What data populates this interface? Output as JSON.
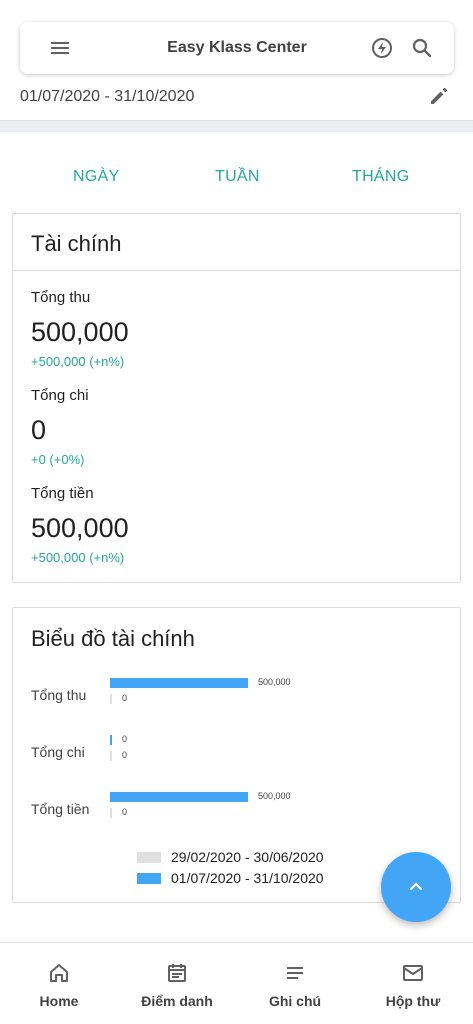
{
  "header": {
    "title": "Easy Klass Center",
    "icons": {
      "menu": "menu-icon",
      "flash": "flash-icon",
      "search": "search-icon"
    }
  },
  "date_range": {
    "value": "01/07/2020 - 31/10/2020",
    "edit_icon": "pencil-icon"
  },
  "tabs": [
    {
      "label": "NGÀY"
    },
    {
      "label": "TUẦN"
    },
    {
      "label": "THÁNG"
    }
  ],
  "finance": {
    "title": "Tài chính",
    "metrics": [
      {
        "label": "Tổng thu",
        "value": "500,000",
        "delta": "+500,000 (+n%)"
      },
      {
        "label": "Tổng chi",
        "value": "0",
        "delta": "+0 (+0%)"
      },
      {
        "label": "Tổng tiền",
        "value": "500,000",
        "delta": "+500,000 (+n%)"
      }
    ]
  },
  "chart": {
    "title": "Biểu đồ tài chính",
    "rows": [
      {
        "label": "Tổng thu",
        "current": 500000,
        "previous": 0,
        "current_label": "500,000",
        "previous_label": "0"
      },
      {
        "label": "Tổng chi",
        "current": 0,
        "previous": 0,
        "current_label": "0",
        "previous_label": "0"
      },
      {
        "label": "Tổng tiền",
        "current": 500000,
        "previous": 0,
        "current_label": "500,000",
        "previous_label": "0"
      }
    ],
    "legend": [
      {
        "label": "29/02/2020 - 30/06/2020",
        "color": "#e0e0e0"
      },
      {
        "label": "01/07/2020 - 31/10/2020",
        "color": "#42a5f5"
      }
    ]
  },
  "chart_data": {
    "type": "bar",
    "orientation": "horizontal",
    "categories": [
      "Tổng thu",
      "Tổng chi",
      "Tổng tiền"
    ],
    "series": [
      {
        "name": "29/02/2020 - 30/06/2020",
        "values": [
          0,
          0,
          0
        ]
      },
      {
        "name": "01/07/2020 - 31/10/2020",
        "values": [
          500000,
          0,
          500000
        ]
      }
    ],
    "title": "Biểu đồ tài chính",
    "legend": "bottom",
    "grid": false
  },
  "fab": {
    "icon": "chevron-up-icon"
  },
  "bottom_nav": [
    {
      "label": "Home",
      "icon": "home-icon"
    },
    {
      "label": "Điểm danh",
      "icon": "calendar-icon"
    },
    {
      "label": "Ghi chú",
      "icon": "notes-icon"
    },
    {
      "label": "Hộp thư",
      "icon": "mail-icon"
    }
  ],
  "colors": {
    "accent": "#26a69a",
    "bar_current": "#42a5f5",
    "bar_previous": "#e0e0e0",
    "fab": "#42a5f5"
  }
}
